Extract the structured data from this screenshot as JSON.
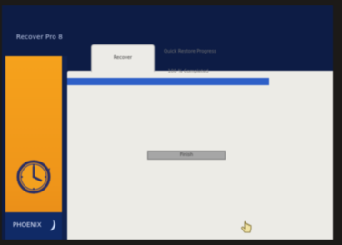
{
  "app": {
    "title": "Recover Pro 8"
  },
  "tabs": [
    {
      "label": "Recover"
    }
  ],
  "recovery": {
    "heading": "Quick Restore Progress",
    "percent_label": "100 % Completed",
    "progress": 1.0,
    "finish_label": "Finish"
  },
  "brand": {
    "text": "PHOENIX"
  },
  "colors": {
    "accent": "#2e5fc7",
    "sidebar": "#f6a21c",
    "background": "#0d1c45",
    "panel": "#ecebe6"
  },
  "icons": [
    "clock-icon",
    "phoenix-logo-icon",
    "hand-cursor-icon"
  ]
}
